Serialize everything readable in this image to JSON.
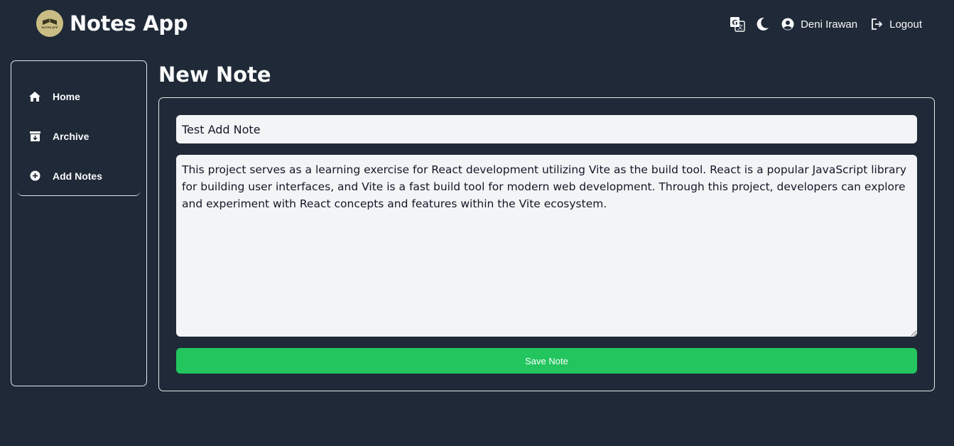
{
  "header": {
    "app_title": "Notes App",
    "logo_text": "NOTES APP",
    "user_name": "Deni Irawan",
    "logout_label": "Logout",
    "icons": {
      "translate": "translate-icon",
      "theme": "moon-icon",
      "user": "user-circle-icon",
      "logout": "logout-icon"
    }
  },
  "sidebar": {
    "items": [
      {
        "label": "Home",
        "icon": "home-icon"
      },
      {
        "label": "Archive",
        "icon": "archive-icon"
      },
      {
        "label": "Add Notes",
        "icon": "plus-circle-icon",
        "active": true
      }
    ]
  },
  "main": {
    "page_title": "New Note",
    "form": {
      "title_value": "Test Add Note",
      "body_value": "This project serves as a learning exercise for React development utilizing Vite as the build tool. React is a popular JavaScript library for building user interfaces, and Vite is a fast build tool for modern web development. Through this project, developers can explore and experiment with React concepts and features within the Vite ecosystem.",
      "save_label": "Save Note"
    }
  },
  "colors": {
    "background": "#1f2937",
    "input_bg": "#f3f4f6",
    "accent": "#22c55e",
    "border": "#e5e7eb"
  }
}
